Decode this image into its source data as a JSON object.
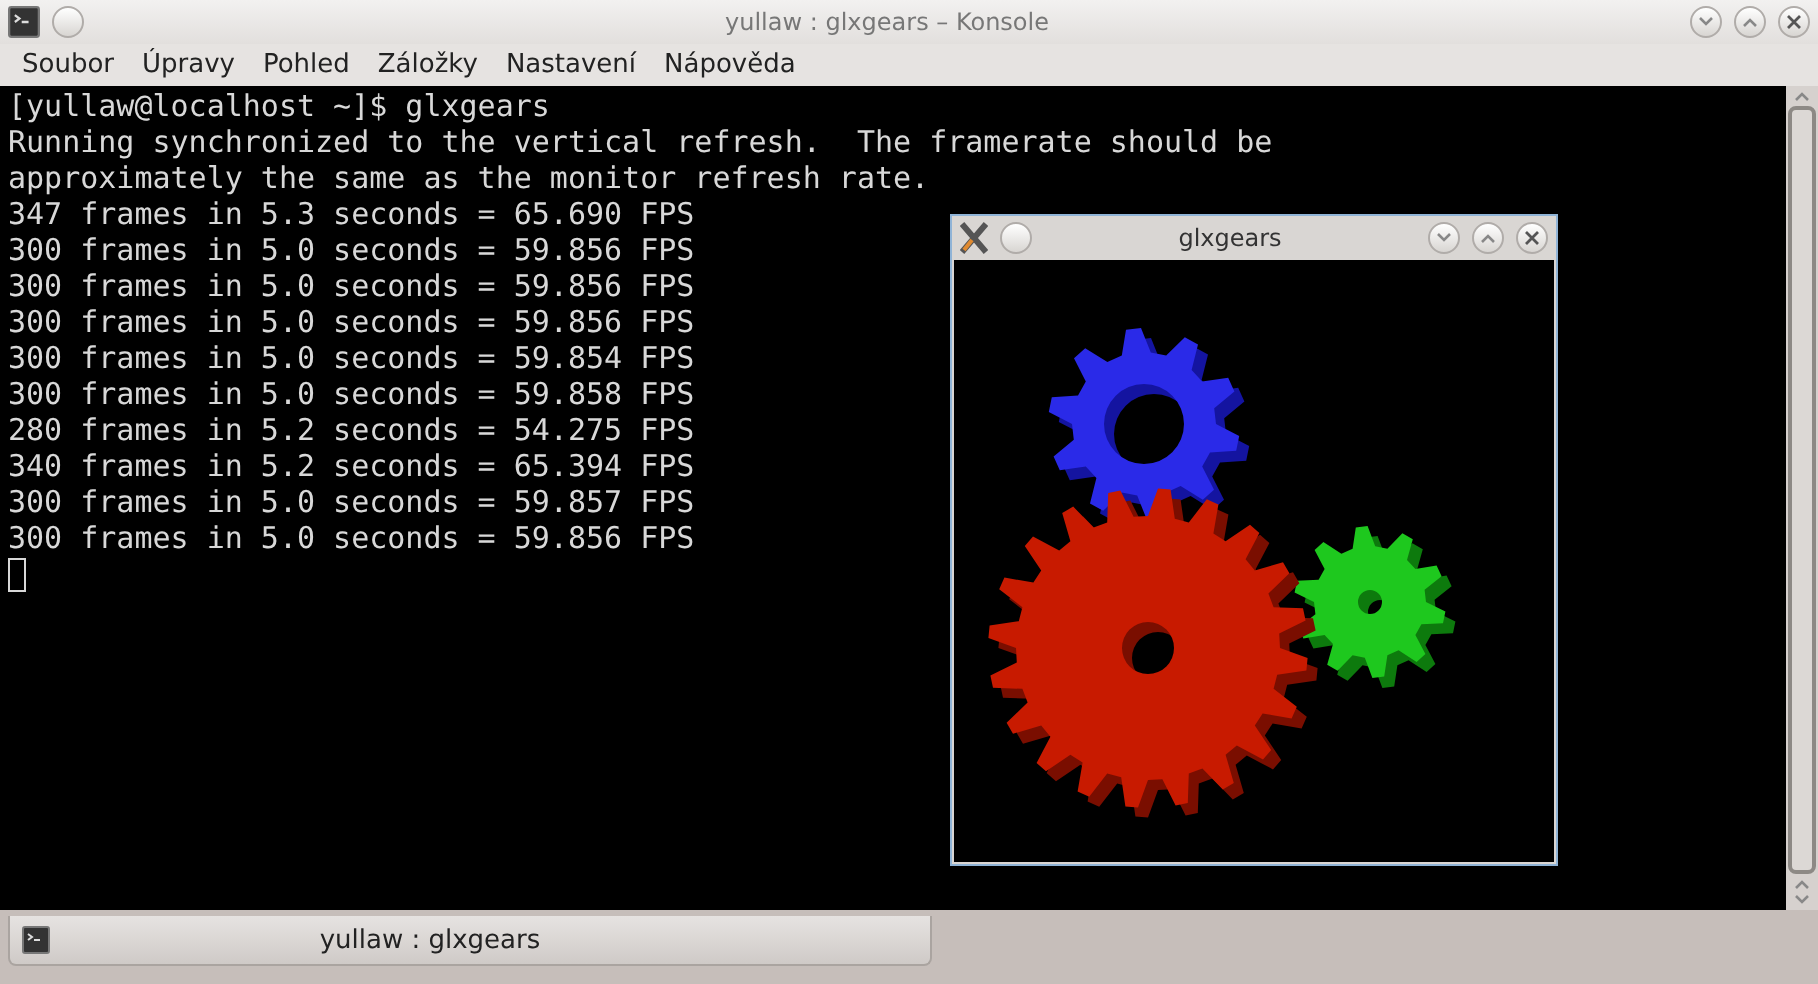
{
  "window": {
    "title": "yullaw : glxgears – Konsole"
  },
  "menu": [
    "Soubor",
    "Úpravy",
    "Pohled",
    "Záložky",
    "Nastavení",
    "Nápověda"
  ],
  "terminal": {
    "lines": [
      "[yullaw@localhost ~]$ glxgears",
      "Running synchronized to the vertical refresh.  The framerate should be",
      "approximately the same as the monitor refresh rate.",
      "347 frames in 5.3 seconds = 65.690 FPS",
      "300 frames in 5.0 seconds = 59.856 FPS",
      "300 frames in 5.0 seconds = 59.856 FPS",
      "300 frames in 5.0 seconds = 59.856 FPS",
      "300 frames in 5.0 seconds = 59.854 FPS",
      "300 frames in 5.0 seconds = 59.858 FPS",
      "280 frames in 5.2 seconds = 54.275 FPS",
      "340 frames in 5.2 seconds = 65.394 FPS",
      "300 frames in 5.0 seconds = 59.857 FPS",
      "300 frames in 5.0 seconds = 59.856 FPS"
    ]
  },
  "gl_window": {
    "title": "glxgears"
  },
  "tabs": [
    {
      "label": "yullaw : glxgears",
      "selected": true
    }
  ]
}
